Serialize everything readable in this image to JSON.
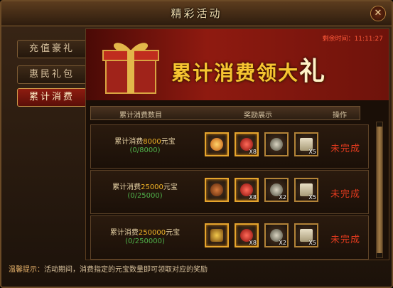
{
  "window": {
    "title": "精彩活动",
    "close_icon": "close-x-icon"
  },
  "sidebar": {
    "tabs": [
      {
        "label": "充值豪礼",
        "active": false
      },
      {
        "label": "惠民礼包",
        "active": false
      },
      {
        "label": "累计消费",
        "active": true
      }
    ]
  },
  "banner": {
    "title_part1": "累计消费领大",
    "title_part2": "礼",
    "countdown": "剩余时间：11:11:27"
  },
  "table": {
    "headers": [
      "累计消费数目",
      "奖励展示",
      "操作"
    ],
    "rows": [
      {
        "prefix": "累计消费",
        "amount": "8000",
        "unit": "元宝",
        "progress": "(0/8000)",
        "items": [
          {
            "icon": "orange-orb-icon",
            "count": ""
          },
          {
            "icon": "red-gem-icon",
            "count": "X8"
          },
          {
            "icon": "spiked-ball-icon",
            "count": ""
          },
          {
            "icon": "scroll-icon",
            "count": "X5"
          }
        ],
        "status": "未完成"
      },
      {
        "prefix": "累计消费",
        "amount": "25000",
        "unit": "元宝",
        "progress": "(0/25000)",
        "items": [
          {
            "icon": "mount-icon",
            "count": ""
          },
          {
            "icon": "red-gem-icon",
            "count": "X8"
          },
          {
            "icon": "spiked-ball-icon",
            "count": "X2"
          },
          {
            "icon": "scroll-icon",
            "count": "X5"
          }
        ],
        "status": "未完成"
      },
      {
        "prefix": "累计消费",
        "amount": "250000",
        "unit": "元宝",
        "progress": "(0/250000)",
        "items": [
          {
            "icon": "treasure-chest-icon",
            "count": ""
          },
          {
            "icon": "red-gem-icon",
            "count": "X8"
          },
          {
            "icon": "spiked-ball-icon",
            "count": "X2"
          },
          {
            "icon": "scroll-icon",
            "count": "X5"
          }
        ],
        "status": "未完成"
      }
    ]
  },
  "tip": {
    "label": "温馨提示：",
    "text": "活动期间，消费指定的元宝数量即可领取对应的奖励"
  },
  "colors": {
    "accent": "#f0b327",
    "status": "#e23a1e",
    "progress": "#4fb14a"
  }
}
